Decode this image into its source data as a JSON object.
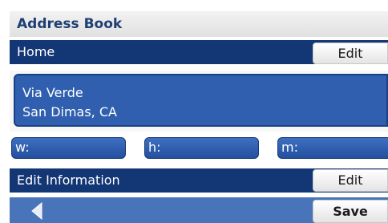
{
  "header": {
    "title": "Address Book"
  },
  "home": {
    "label": "Home",
    "edit_label": "Edit"
  },
  "address": {
    "line1": "Via Verde",
    "line2": "San Dimas, CA"
  },
  "phones": [
    {
      "label": "w:"
    },
    {
      "label": "h:"
    },
    {
      "label": "m:"
    }
  ],
  "edit_info": {
    "label": "Edit Information",
    "edit_label": "Edit"
  },
  "footer": {
    "back_icon": "back-arrow-icon",
    "save_label": "Save"
  },
  "colors": {
    "bar": "#133675",
    "field": "#2f5fae",
    "footer": "#4a74b9"
  }
}
